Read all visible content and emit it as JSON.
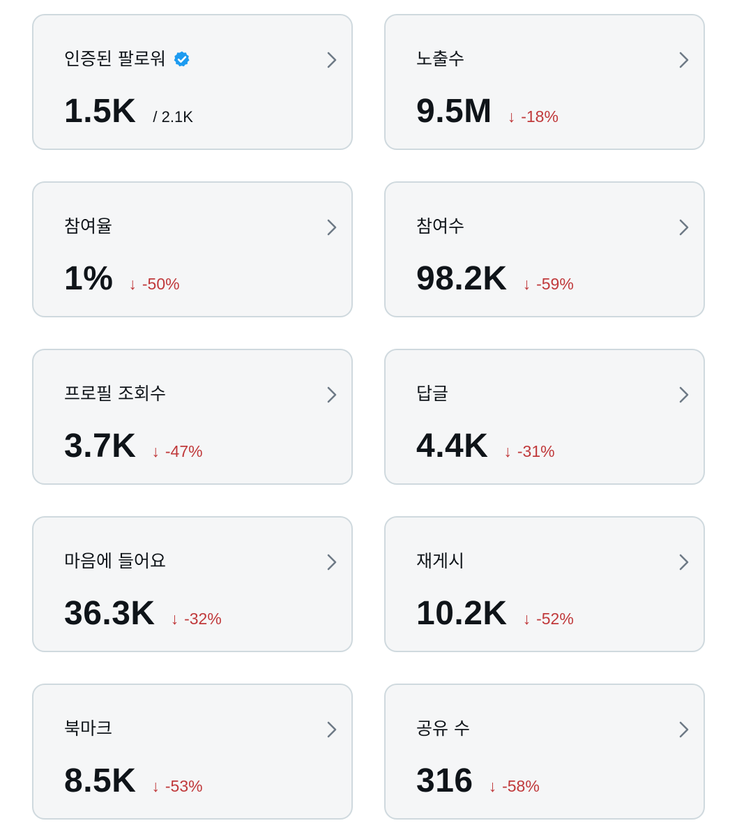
{
  "cards": [
    {
      "label": "인증된 팔로워",
      "value": "1.5K",
      "subtotal": "/ 2.1K",
      "verified": true
    },
    {
      "label": "노출수",
      "value": "9.5M",
      "arrow": "↓",
      "change": "-18%"
    },
    {
      "label": "참여율",
      "value": "1%",
      "arrow": "↓",
      "change": "-50%"
    },
    {
      "label": "참여수",
      "value": "98.2K",
      "arrow": "↓",
      "change": "-59%"
    },
    {
      "label": "프로필 조회수",
      "value": "3.7K",
      "arrow": "↓",
      "change": "-47%"
    },
    {
      "label": "답글",
      "value": "4.4K",
      "arrow": "↓",
      "change": "-31%"
    },
    {
      "label": "마음에 들어요",
      "value": "36.3K",
      "arrow": "↓",
      "change": "-32%"
    },
    {
      "label": "재게시",
      "value": "10.2K",
      "arrow": "↓",
      "change": "-52%"
    },
    {
      "label": "북마크",
      "value": "8.5K",
      "arrow": "↓",
      "change": "-53%"
    },
    {
      "label": "공유 수",
      "value": "316",
      "arrow": "↓",
      "change": "-58%"
    }
  ],
  "colors": {
    "card_bg": "#f5f6f7",
    "card_border": "#cfd9de",
    "negative_change": "#c0393b",
    "verified_badge": "#1d9bf0",
    "text_primary": "#0f1419"
  }
}
